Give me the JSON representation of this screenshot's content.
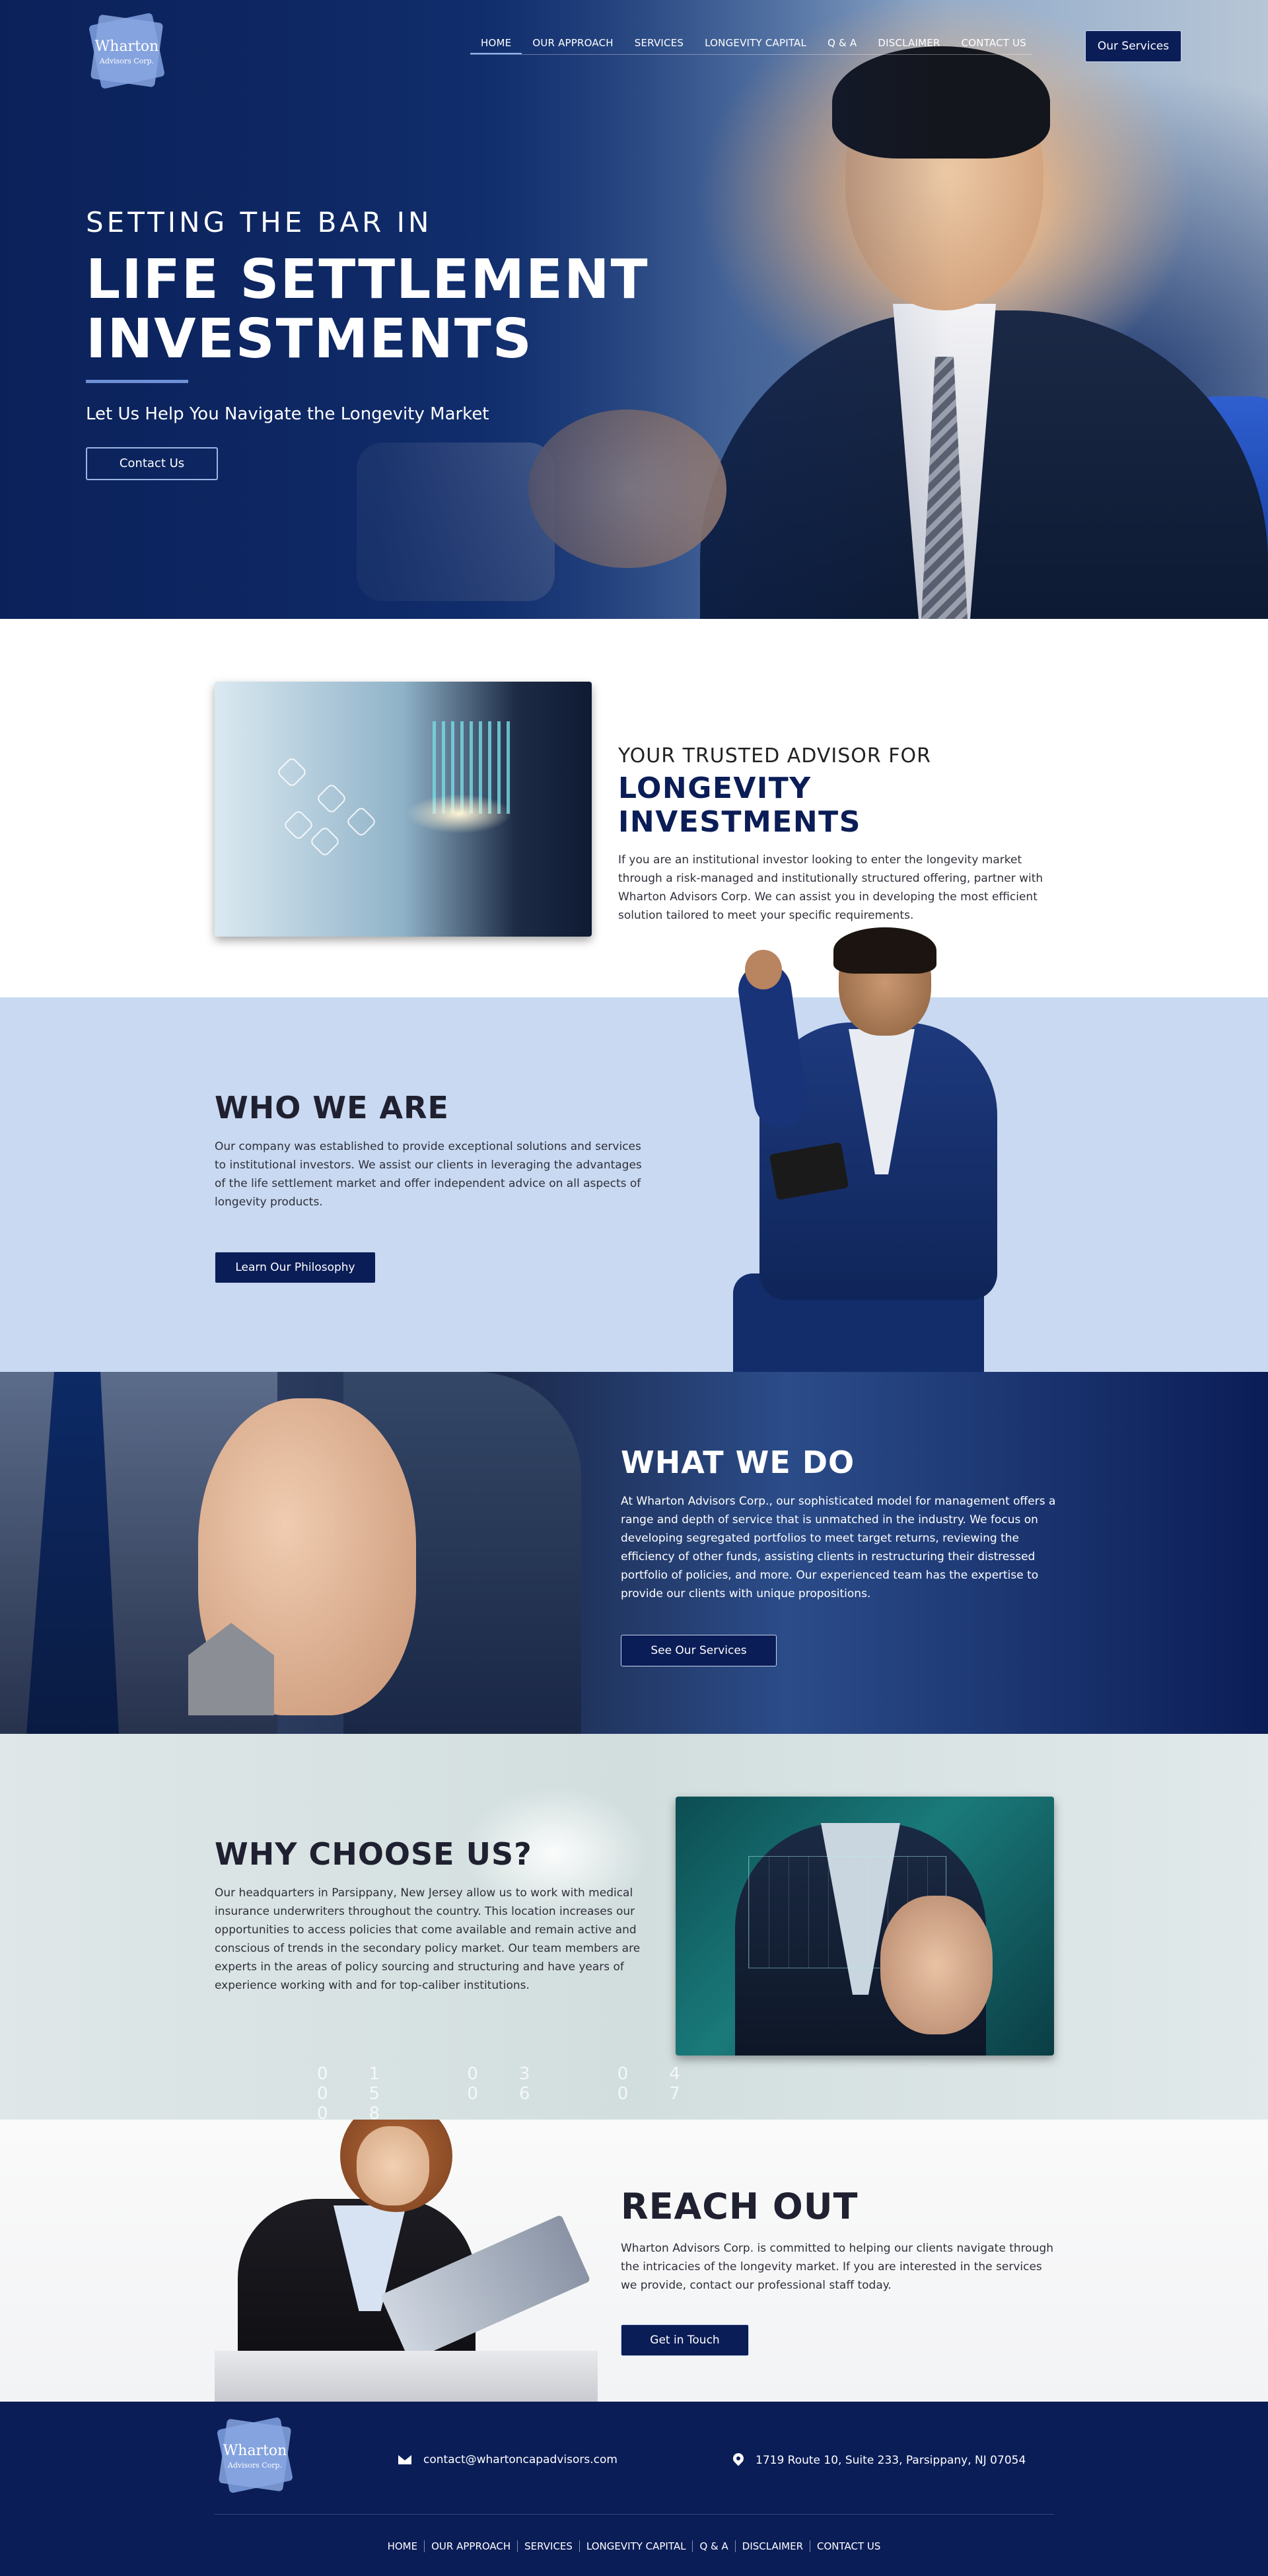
{
  "brand": {
    "name": "Wharton",
    "sub": "Advisors Corp."
  },
  "nav": {
    "items": [
      "HOME",
      "OUR APPROACH",
      "SERVICES",
      "LONGEVITY CAPITAL",
      "Q & A",
      "DISCLAIMER",
      "CONTACT US"
    ],
    "cta": "Our Services"
  },
  "hero": {
    "kicker": "SETTING THE BAR IN",
    "title_line1": "LIFE SETTLEMENT",
    "title_line2": "INVESTMENTS",
    "subtitle": "Let Us Help You Navigate the Longevity Market",
    "button": "Contact Us"
  },
  "advisor": {
    "kicker": "YOUR TRUSTED ADVISOR FOR",
    "title": "LONGEVITY INVESTMENTS",
    "body": "If you are an institutional investor looking to enter the longevity market through a risk-managed and institutionally structured offering, partner with Wharton Advisors Corp. We can assist you in developing the most efficient solution tailored to meet your specific requirements."
  },
  "who": {
    "title": "WHO WE ARE",
    "body": "Our company was established to provide exceptional solutions and services to institutional investors. We assist our clients in leveraging the advantages of the life settlement market and offer independent advice on all aspects of longevity products.",
    "button": "Learn Our Philosophy"
  },
  "what": {
    "title": "WHAT WE DO",
    "body": "At Wharton Advisors Corp., our sophisticated model for management offers a range and depth of service that is unmatched in the industry. We focus on developing segregated portfolios to meet target returns, reviewing the efficiency of other funds, assisting clients in restructuring their distressed portfolio of policies, and more. Our experienced team has the expertise to provide our clients with unique propositions.",
    "button": "See Our Services"
  },
  "why": {
    "title": "WHY CHOOSE US?",
    "body": "Our headquarters in Parsippany, New Jersey allow us to work with medical insurance underwriters throughout the country. This location increases our opportunities to access policies that come available and remain active and conscious of trends in the secondary policy market. Our team members are experts in the areas of policy sourcing and structuring and have years of experience working with and for top-caliber institutions.",
    "bg_numbers": "01 03 04 05 06 07 08"
  },
  "reach": {
    "title": "REACH OUT",
    "body": "Wharton Advisors Corp. is committed to helping our clients navigate through the intricacies of the longevity market. If you are interested in the services we provide, contact our professional staff today.",
    "button": "Get in Touch"
  },
  "footer": {
    "email": "contact@whartoncapadvisors.com",
    "address": "1719 Route 10, Suite 233, Parsippany, NJ 07054",
    "email_icon": "envelope-icon",
    "address_icon": "map-pin-icon",
    "links": [
      "HOME",
      "OUR APPROACH",
      "SERVICES",
      "LONGEVITY CAPITAL",
      "Q & A",
      "DISCLAIMER",
      "CONTACT US"
    ]
  },
  "colors": {
    "navy": "#0b1d57",
    "accent": "#6f90d6",
    "who_bg": "#c8d9f1"
  }
}
